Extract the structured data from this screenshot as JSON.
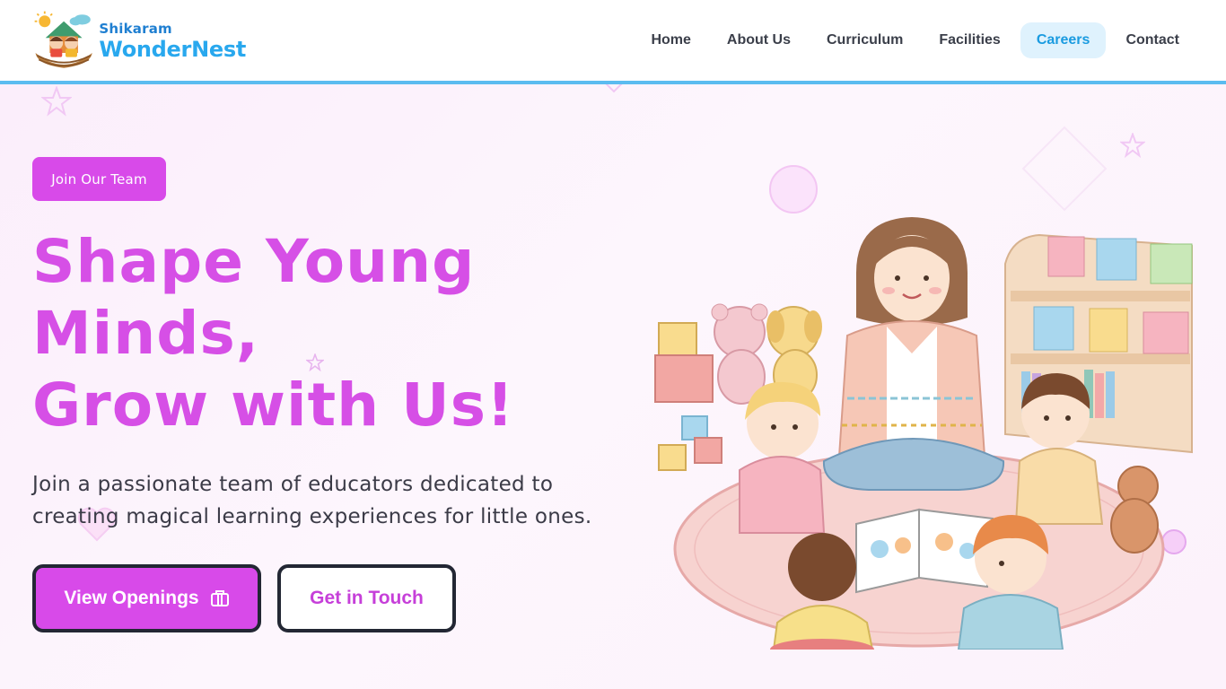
{
  "header": {
    "logo": {
      "small": "Shikaram",
      "big": "WonderNest"
    },
    "nav": [
      {
        "label": "Home",
        "active": false
      },
      {
        "label": "About Us",
        "active": false
      },
      {
        "label": "Curriculum",
        "active": false
      },
      {
        "label": "Facilities",
        "active": false
      },
      {
        "label": "Careers",
        "active": true
      },
      {
        "label": "Contact",
        "active": false
      }
    ]
  },
  "hero": {
    "badge": "Join Our Team",
    "headline": [
      "Shape Young",
      "Minds,",
      "Grow with Us!"
    ],
    "subtext": "Join a passionate team of educators dedicated to creating magical learning experiences for little ones.",
    "primary_button": "View Openings",
    "secondary_button": "Get in Touch"
  },
  "colors": {
    "accent": "#d84ae9",
    "brand_blue": "#29a8ee",
    "nav_active_bg": "#dff2fd",
    "header_border": "#5bbcf0",
    "dark_outline": "#232734"
  },
  "icons": {
    "primary_button_icon": "briefcase-icon"
  }
}
